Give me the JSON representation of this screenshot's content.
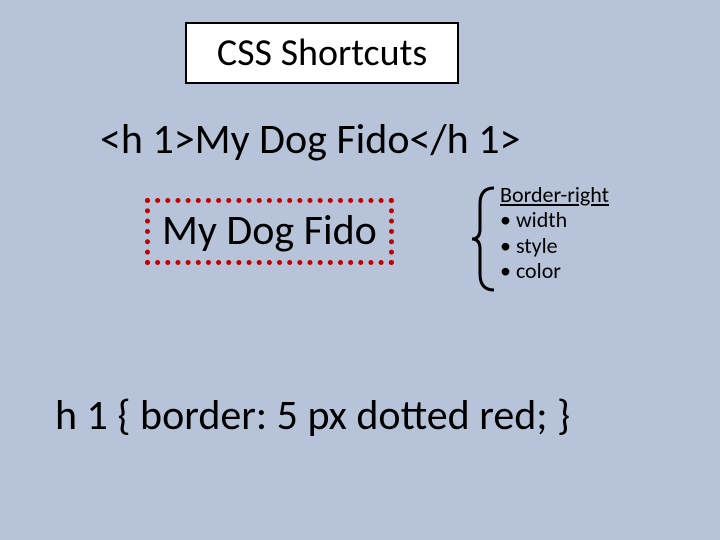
{
  "title": "CSS Shortcuts",
  "code_example": "<h 1>My Dog Fido</h 1>",
  "rendered_text": "My Dog Fido",
  "annotation": {
    "heading": "Border-right",
    "items": [
      "width",
      "style",
      "color"
    ]
  },
  "css_rule": "h 1 { border: 5 px dotted red; }"
}
